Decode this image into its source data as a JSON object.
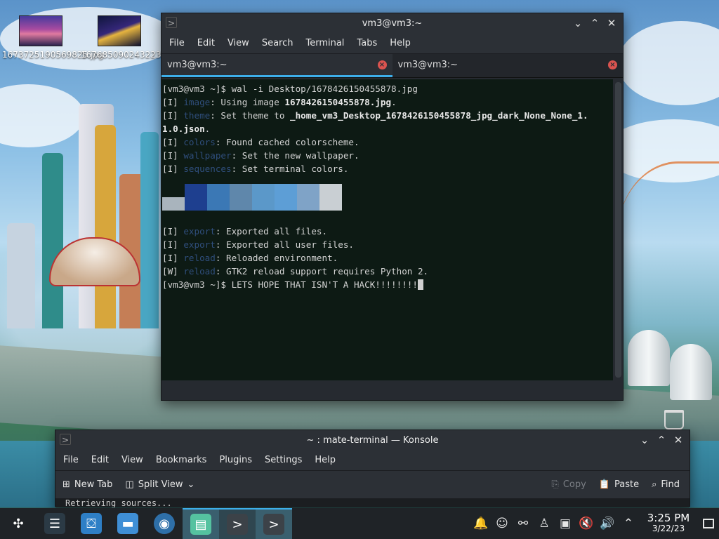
{
  "desktop": {
    "icons": [
      {
        "label": "1673725190569825.jpg"
      },
      {
        "label": "1676850902432231.jpg"
      }
    ]
  },
  "terminal": {
    "title": "vm3@vm3:~",
    "menu": [
      "File",
      "Edit",
      "View",
      "Search",
      "Terminal",
      "Tabs",
      "Help"
    ],
    "tabs": [
      {
        "label": "vm3@vm3:~",
        "active": true
      },
      {
        "label": "vm3@vm3:~",
        "active": false
      }
    ],
    "lines": [
      {
        "prompt": "[vm3@vm3 ~]$ ",
        "text": "wal -i Desktop/1678426150455878.jpg"
      },
      {
        "tag": "[I] ",
        "key": "image",
        "text": ": Using image ",
        "bold": "1678426150455878.jpg",
        "tail": "."
      },
      {
        "tag": "[I] ",
        "key": "theme",
        "text": ": Set theme to ",
        "bold": "_home_vm3_Desktop_1678426150455878_jpg_dark_None_None_1.\n1.0.json",
        "tail": "."
      },
      {
        "tag": "[I] ",
        "key": "colors",
        "text": ": Found cached colorscheme."
      },
      {
        "tag": "[I] ",
        "key": "wallpaper",
        "text": ": Set the new wallpaper."
      },
      {
        "tag": "[I] ",
        "key": "sequences",
        "text": ": Set terminal colors."
      }
    ],
    "palette": [
      "#a9b4bd",
      "#1e3f8f",
      "#3b78b5",
      "#5f87ab",
      "#5b98c9",
      "#5d9ed6",
      "#7fa3c7",
      "#c9cfd3"
    ],
    "lines_after": [
      {
        "tag": "[I] ",
        "key": "export",
        "text": ": Exported all files."
      },
      {
        "tag": "[I] ",
        "key": "export",
        "text": ": Exported all user files."
      },
      {
        "tag": "[I] ",
        "key": "reload",
        "text": ": Reloaded environment."
      },
      {
        "tag": "[W] ",
        "key": "reload",
        "text": ": GTK2 reload support requires Python 2."
      }
    ],
    "last_prompt": "[vm3@vm3 ~]$ ",
    "last_input": "LETS HOPE THAT ISN'T A HACK!!!!!!!!"
  },
  "konsole": {
    "title": "~ : mate-terminal — Konsole",
    "menu": [
      "File",
      "Edit",
      "View",
      "Bookmarks",
      "Plugins",
      "Settings",
      "Help"
    ],
    "toolbar": {
      "new_tab": "New Tab",
      "split_view": "Split View",
      "copy": "Copy",
      "paste": "Paste",
      "find": "Find"
    },
    "partial_text": "Retrieving sources..."
  },
  "taskbar": {
    "time": "3:25 PM",
    "date": "3/22/23"
  },
  "colors": {
    "accent": "#3daee9",
    "term_bg": "#0d1a14",
    "label_blue": "#2f4e7c"
  }
}
